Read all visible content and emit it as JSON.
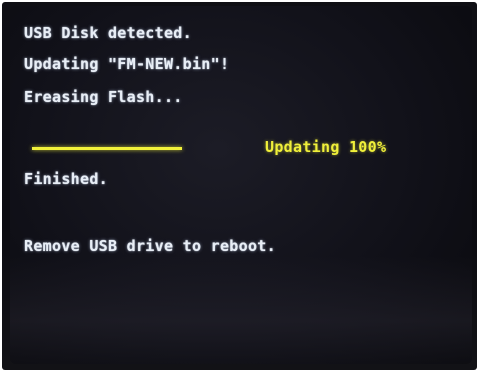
{
  "console": {
    "line1": "USB Disk detected.",
    "line2": "Updating \"FM-NEW.bin\"!",
    "line3": "Ereasing Flash...",
    "progress_label": "Updating 100%",
    "progress_value": 1.0,
    "line4": "Finished.",
    "line5": "Remove USB drive to reboot."
  },
  "colors": {
    "text": "#e8eef6",
    "progress": "#f2f23a",
    "screen_bg": "#111119"
  }
}
